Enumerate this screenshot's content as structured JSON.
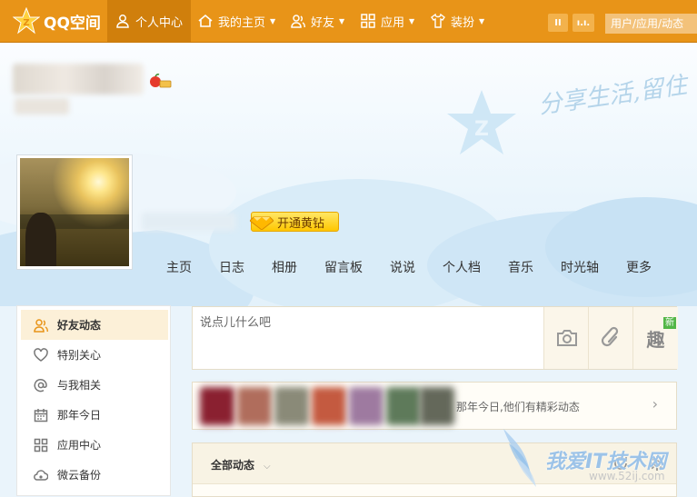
{
  "topnav": {
    "brand": "QQ空间",
    "items": [
      {
        "label": "个人中心",
        "icon": "person-icon"
      },
      {
        "label": "我的主页",
        "icon": "home-icon"
      },
      {
        "label": "好友",
        "icon": "friends-icon"
      },
      {
        "label": "应用",
        "icon": "apps-grid-icon"
      },
      {
        "label": "装扮",
        "icon": "tshirt-icon"
      }
    ],
    "btn1": "II",
    "btn2": "ı.ı.",
    "search_placeholder": "用户/应用/动态"
  },
  "header": {
    "slogan": "分享生活,留住",
    "vip_button": "开通黄钻"
  },
  "profile_tabs": [
    "主页",
    "日志",
    "相册",
    "留言板",
    "说说",
    "个人档",
    "音乐",
    "时光轴",
    "更多"
  ],
  "sidebar": {
    "items": [
      {
        "label": "好友动态",
        "icon": "friends-feed-icon",
        "active": true
      },
      {
        "label": "特别关心",
        "icon": "heart-icon",
        "active": false
      },
      {
        "label": "与我相关",
        "icon": "at-icon",
        "active": false
      },
      {
        "label": "那年今日",
        "icon": "calendar-icon",
        "active": false
      },
      {
        "label": "应用中心",
        "icon": "apps-grid-icon",
        "active": false
      },
      {
        "label": "微云备份",
        "icon": "cloud-backup-icon",
        "active": false
      }
    ]
  },
  "composer": {
    "placeholder": "说点儿什么吧",
    "tools": [
      "camera-icon",
      "link-icon",
      "fun-icon"
    ],
    "fun_glyph": "趣",
    "new_badge": "新"
  },
  "memory": {
    "text": "那年今日,他们有精彩动态",
    "arrow": "›"
  },
  "feed": {
    "filter_label": "全部动态",
    "chevron": "⌵"
  },
  "watermark": {
    "title": "我爱IT技术网",
    "url": "www.52ij.com"
  },
  "colors": {
    "topbar": "#e89418",
    "accent": "#f7b43a",
    "active_side": "#fcf0d8"
  }
}
